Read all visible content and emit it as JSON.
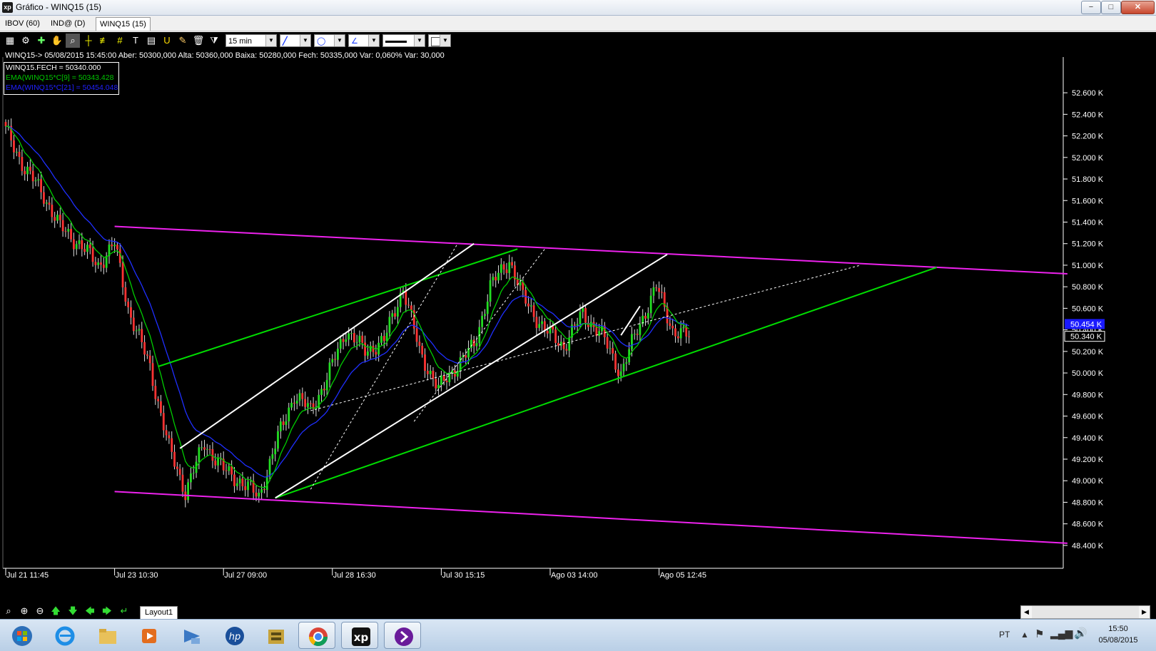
{
  "window": {
    "title": "Gráfico - WINQ15 (15)",
    "app_icon": "xp",
    "controls": {
      "minimize": "−",
      "maximize": "□",
      "close": "✕"
    }
  },
  "tabs": [
    {
      "label": "IBOV (60)",
      "active": false
    },
    {
      "label": "IND@ (D)",
      "active": false
    },
    {
      "label": "WINQ15 (15)",
      "active": true
    }
  ],
  "toolbar": {
    "period_select": "15 min",
    "icons": [
      "chart-type-icon",
      "settings-icon",
      "crosshair-icon",
      "zoom-window-icon",
      "hand-icon",
      "cursor-icon",
      "fibonacci-icon",
      "grid-icon",
      "text-icon",
      "magnet-icon",
      "brush-icon",
      "delete-icon",
      "filter-icon"
    ]
  },
  "info_line": "WINQ15-> 05/08/2015 15:45:00 Aber: 50300,000 Alta: 50360,000 Baixa: 50280,000 Fech: 50335,000 Var: 0,060% Var: 30,000",
  "legend": [
    {
      "text": "WINQ15.FECH = 50340.000",
      "color": "#ffffff"
    },
    {
      "text": "EMA(WINQ15*C[9] = 50343.428",
      "color": "#00c800"
    },
    {
      "text": "EMA(WINQ15*C[21] = 50454.048",
      "color": "#2020ff"
    }
  ],
  "chart_data": {
    "type": "line",
    "symbol": "WINQ15",
    "interval": "15 min",
    "y_axis": {
      "ticks": [
        "52.600 K",
        "52.400 K",
        "52.200 K",
        "52.000 K",
        "51.800 K",
        "51.600 K",
        "51.400 K",
        "51.200 K",
        "51.000 K",
        "50.800 K",
        "50.600 K",
        "50.400 K",
        "50.200 K",
        "50.000 K",
        "49.800 K",
        "49.600 K",
        "49.400 K",
        "49.200 K",
        "49.000 K",
        "48.800 K",
        "48.600 K",
        "48.400 K"
      ],
      "tick_values": [
        52600,
        52400,
        52200,
        52000,
        51800,
        51600,
        51400,
        51200,
        51000,
        50800,
        50600,
        50400,
        50200,
        50000,
        49800,
        49600,
        49400,
        49200,
        49000,
        48800,
        48600,
        48400
      ],
      "ylim": [
        48300,
        52700
      ],
      "markers": [
        {
          "label": "50.454 K",
          "value": 50454,
          "bg": "#1a1aff",
          "fg": "#ffffff"
        },
        {
          "label": "50.340 K",
          "value": 50340,
          "bg": "#000000",
          "fg": "#ffffff"
        }
      ]
    },
    "x_axis": {
      "labels": [
        "Jul 21 11:45",
        "Jul 23 10:30",
        "Jul 27 09:00",
        "Jul 28 16:30",
        "Jul 30 15:15",
        "Ago 03 14:00",
        "Ago 05 12:45"
      ],
      "label_index": [
        0,
        40,
        80,
        120,
        160,
        200,
        240
      ]
    },
    "close_anchors": [
      [
        0,
        52250
      ],
      [
        7,
        51900
      ],
      [
        14,
        51650
      ],
      [
        20,
        51350
      ],
      [
        27,
        51200
      ],
      [
        34,
        51000
      ],
      [
        40,
        51200
      ],
      [
        45,
        50600
      ],
      [
        53,
        50050
      ],
      [
        60,
        49300
      ],
      [
        66,
        48900
      ],
      [
        73,
        49350
      ],
      [
        80,
        49100
      ],
      [
        86,
        49000
      ],
      [
        93,
        48850
      ],
      [
        100,
        49400
      ],
      [
        106,
        49800
      ],
      [
        112,
        49650
      ],
      [
        118,
        49950
      ],
      [
        125,
        50400
      ],
      [
        132,
        50200
      ],
      [
        139,
        50300
      ],
      [
        146,
        50800
      ],
      [
        152,
        50200
      ],
      [
        159,
        49850
      ],
      [
        165,
        50050
      ],
      [
        172,
        50250
      ],
      [
        178,
        50800
      ],
      [
        185,
        51050
      ],
      [
        190,
        50700
      ],
      [
        198,
        50400
      ],
      [
        205,
        50250
      ],
      [
        212,
        50550
      ],
      [
        219,
        50350
      ],
      [
        226,
        50000
      ],
      [
        232,
        50400
      ],
      [
        239,
        50800
      ],
      [
        245,
        50400
      ],
      [
        251,
        50330
      ]
    ],
    "ema9_last": 50343.428,
    "ema21_last": 50454.048,
    "drawings": [
      {
        "color": "#ee22ee",
        "style": "solid",
        "from": [
          40,
          51360
        ],
        "to": [
          390,
          50920
        ]
      },
      {
        "color": "#ee22ee",
        "style": "solid",
        "from": [
          40,
          48900
        ],
        "to": [
          390,
          48420
        ]
      },
      {
        "color": "#00dd00",
        "style": "solid",
        "from": [
          56,
          50060
        ],
        "to": [
          188,
          51150
        ]
      },
      {
        "color": "#00dd00",
        "style": "solid",
        "from": [
          99,
          48840
        ],
        "to": [
          342,
          50980
        ]
      },
      {
        "color": "#ffffff",
        "style": "solid",
        "from": [
          64,
          49300
        ],
        "to": [
          172,
          51200
        ]
      },
      {
        "color": "#ffffff",
        "style": "solid",
        "from": [
          99,
          48840
        ],
        "to": [
          243,
          51100
        ]
      },
      {
        "color": "#ffffff",
        "style": "dashed",
        "from": [
          112,
          48920
        ],
        "to": [
          166,
          51200
        ]
      },
      {
        "color": "#ffffff",
        "style": "dashed",
        "from": [
          150,
          49550
        ],
        "to": [
          198,
          51150
        ]
      },
      {
        "color": "#ffffff",
        "style": "dashed",
        "from": [
          112,
          49650
        ],
        "to": [
          314,
          51000
        ]
      },
      {
        "color": "#ffffff",
        "style": "solid",
        "from": [
          226,
          50350
        ],
        "to": [
          233,
          50620
        ]
      }
    ]
  },
  "bottom_bar": {
    "nav_icons": [
      "zoom-fit-icon",
      "zoom-in-icon",
      "zoom-out-icon",
      "arrow-up-icon",
      "arrow-down-icon",
      "arrow-left-icon",
      "arrow-right-icon",
      "arrow-end-icon"
    ],
    "layout_tab": "Layout1"
  },
  "taskbar": {
    "apps": [
      "windows-start-icon",
      "internet-explorer-icon",
      "file-explorer-icon",
      "media-player-icon",
      "network-app-icon",
      "hp-icon",
      "archive-icon",
      "chrome-icon",
      "xp-app-icon",
      "purple-app-icon"
    ],
    "language": "PT",
    "time": "15:50",
    "date": "05/08/2015"
  }
}
